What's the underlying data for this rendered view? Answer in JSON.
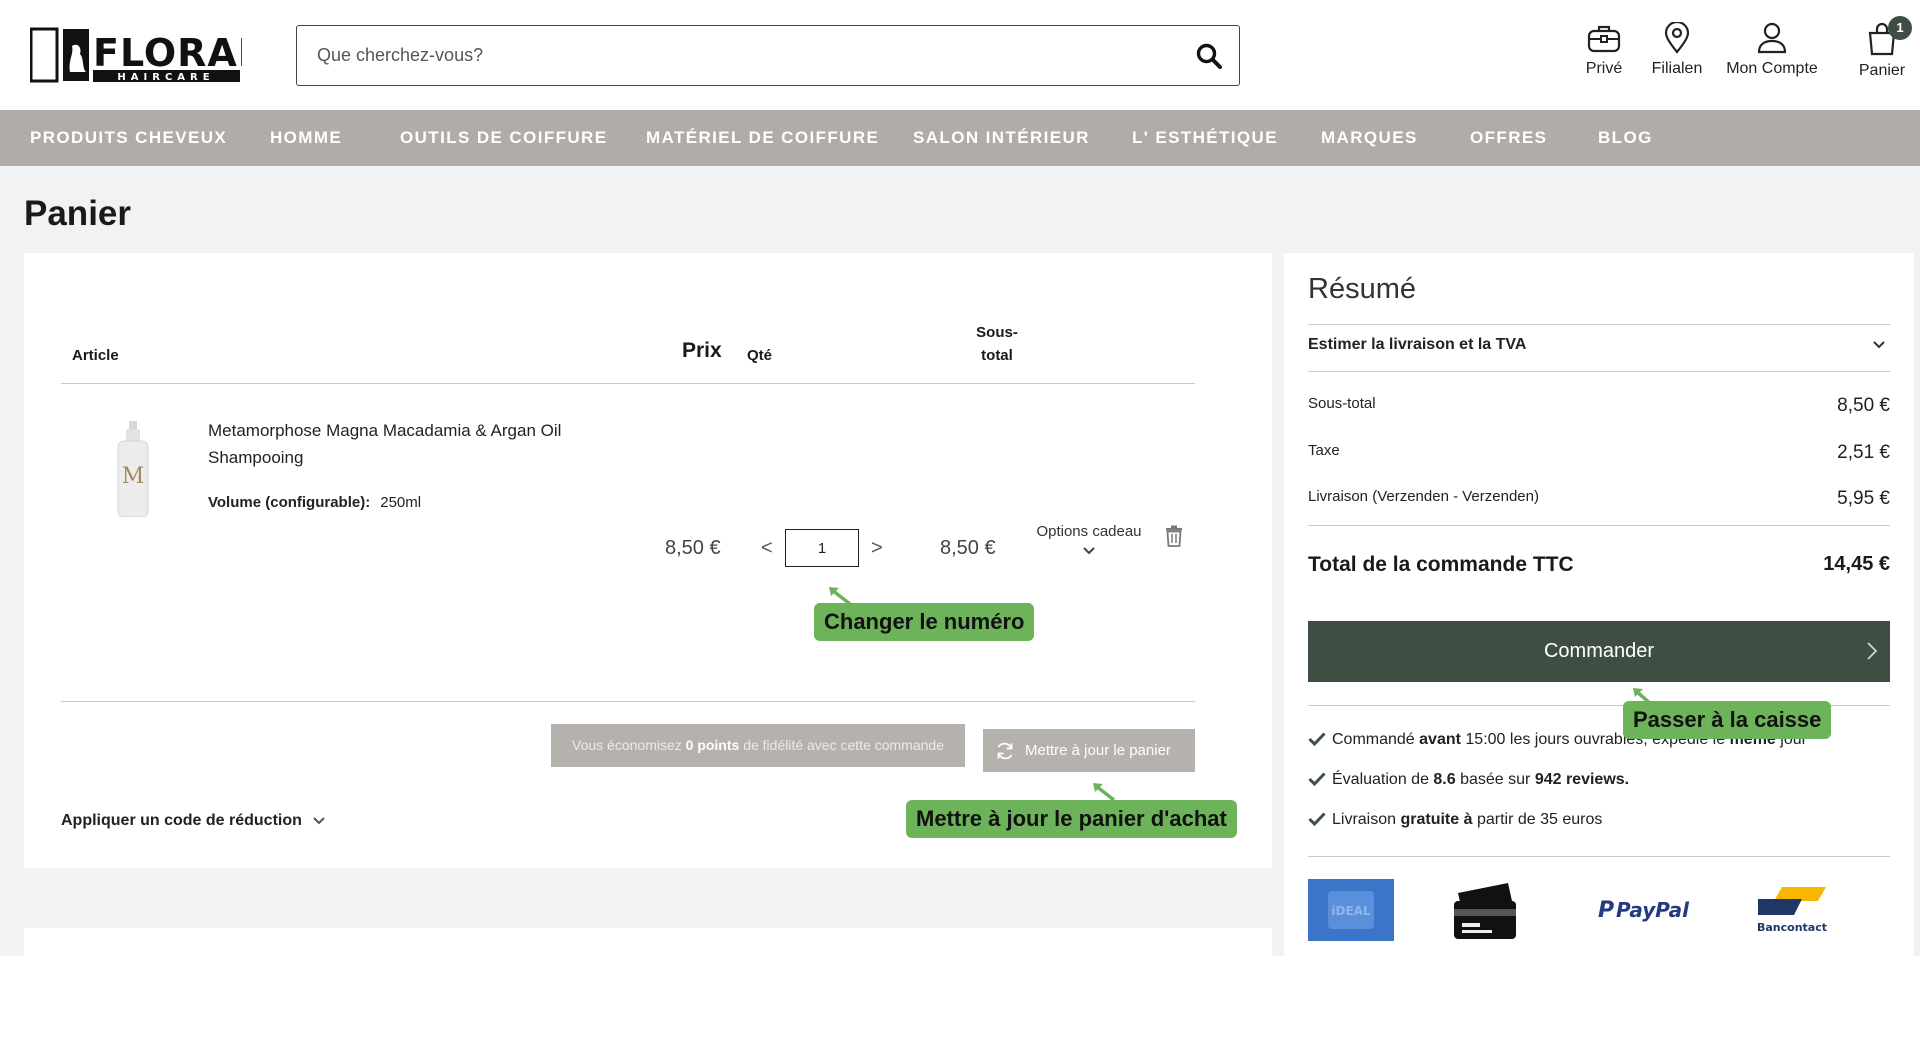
{
  "header": {
    "brand": "FLORALE",
    "brand_sub": "HAIRCARE",
    "search_placeholder": "Que cherchez-vous?",
    "icons": [
      {
        "name": "briefcase-icon",
        "label": "Privé"
      },
      {
        "name": "location-pin-icon",
        "label": "Filialen"
      },
      {
        "name": "user-icon",
        "label": "Mon Compte"
      },
      {
        "name": "cart-icon",
        "label": "Panier",
        "badge": "1"
      }
    ]
  },
  "nav": {
    "items": [
      "PRODUITS CHEVEUX",
      "HOMME",
      "OUTILS DE COIFFURE",
      "MATÉRIEL DE COIFFURE",
      "SALON INTÉRIEUR",
      "L' ESTHÉTIQUE",
      "MARQUES",
      "OFFRES",
      "BLOG"
    ]
  },
  "page": {
    "title": "Panier"
  },
  "cart": {
    "headers": {
      "article": "Article",
      "price": "Prix",
      "qty": "Qté",
      "subtotal_1": "Sous-",
      "subtotal_2": "total"
    },
    "item": {
      "name": "Metamorphose Magna Macadamia & Argan Oil Shampooing",
      "variant_label": "Volume (configurable):",
      "variant_value": "250ml",
      "price": "8,50 €",
      "qty": "1",
      "qty_dec": "<",
      "qty_inc": ">",
      "subtotal": "8,50 €",
      "gift_options": "Options cadeau"
    },
    "loyalty": {
      "pre": "Vous économisez ",
      "points": "0 points",
      "post": " de fidélité avec cette commande"
    },
    "update_button": "Mettre à jour le panier",
    "discount_link": "Appliquer un code de réduction"
  },
  "summary": {
    "title": "Résumé",
    "estimate": "Estimer la livraison et la TVA",
    "rows": [
      {
        "label": "Sous-total",
        "value": "8,50 €"
      },
      {
        "label": "Taxe",
        "value": "2,51 €"
      },
      {
        "label": "Livraison (Verzenden - Verzenden)",
        "value": "5,95 €"
      }
    ],
    "total": {
      "label": "Total de la commande TTC",
      "value": "14,45 €"
    },
    "checkout_button": "Commander",
    "usps": {
      "u1": [
        "Commandé ",
        "avant",
        " 15:00 les jours ouvrables, expédié le ",
        "même",
        " jour"
      ],
      "u2": [
        "Évaluation de ",
        "8.6",
        " basée sur ",
        "942 reviews."
      ],
      "u3": [
        "Livraison ",
        "gratuite à",
        " partir de 35 euros"
      ]
    },
    "payments": [
      "iDEAL",
      "PayPal",
      "Bancontact"
    ]
  },
  "annotations": {
    "change_number": "Changer le numéro",
    "checkout": "Passer à la caisse",
    "update_cart": "Mettre à jour le panier d'achat"
  },
  "colors": {
    "accent": "#3e4e42",
    "nav": "#b1aca7",
    "callout": "#6cb35a",
    "muted_button": "#b5b1ad"
  }
}
